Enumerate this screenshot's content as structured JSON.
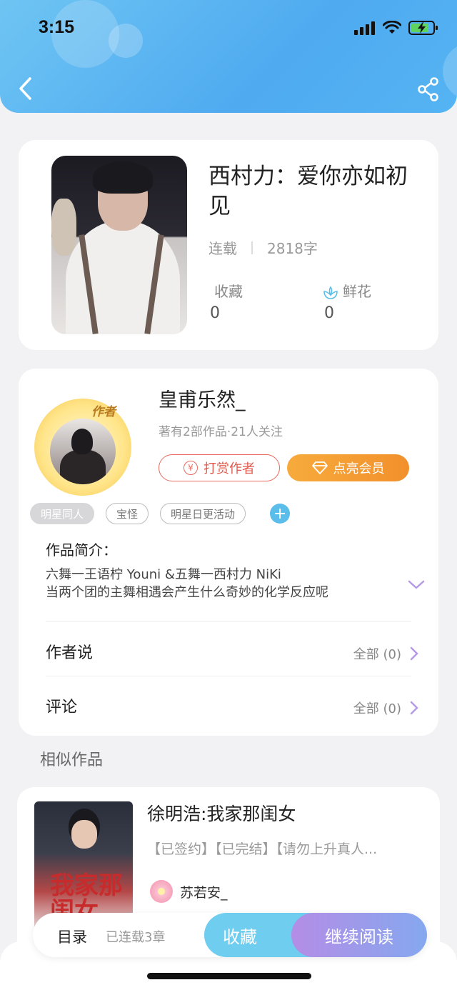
{
  "status_bar": {
    "time": "3:15"
  },
  "book": {
    "title": "西村力：爱你亦如初见",
    "status": "连载",
    "word_count": "2818字",
    "favorites_label": "收藏",
    "favorites_value": "0",
    "flowers_label": "鲜花",
    "flowers_value": "0"
  },
  "author": {
    "badge": "作者",
    "name": "皇甫乐然_",
    "meta": "著有2部作品·21人关注",
    "tip_button": "打赏作者",
    "vip_button": "点亮会员"
  },
  "tags": [
    "明星同人",
    "宝怪",
    "明星日更活动"
  ],
  "intro": {
    "label": "作品简介：",
    "line1": "六舞一王语柠 Youni &五舞一西村力 NiKi",
    "line2": "当两个团的主舞相遇会产生什么奇妙的化学反应呢"
  },
  "author_says": {
    "label": "作者说",
    "right": "全部 (0)"
  },
  "comments": {
    "label": "评论",
    "right": "全部 (0)"
  },
  "similar": {
    "section_title": "相似作品",
    "items": [
      {
        "title": "徐明浩:我家那闺女",
        "tags": "【已签约】【已完结】【请勿上升真人...",
        "author": "苏若安_",
        "cover_text": "我家那闺女"
      }
    ]
  },
  "bottom_bar": {
    "toc_label": "目录",
    "toc_count": "已连载3章",
    "favorite_button": "收藏",
    "read_button": "继续阅读"
  },
  "colors": {
    "header_blue": "#55b4f3",
    "accent_red": "#e25a4c",
    "accent_orange": "#f2902c",
    "accent_cyan": "#6fcdf0",
    "accent_purple": "#b48de6"
  }
}
